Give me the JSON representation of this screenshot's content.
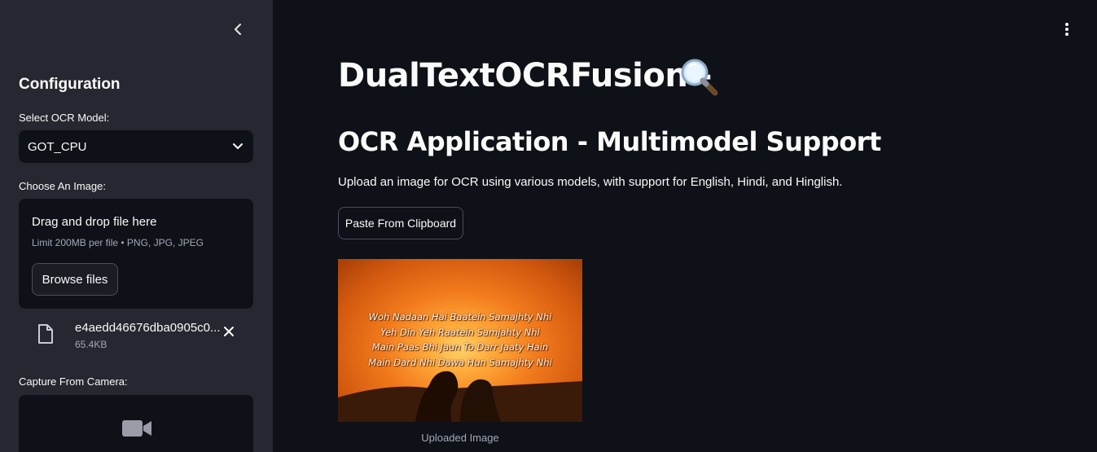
{
  "sidebar": {
    "heading": "Configuration",
    "model_label": "Select OCR Model:",
    "model_value": "GOT_CPU",
    "image_label": "Choose An Image:",
    "dropzone_title": "Drag and drop file here",
    "dropzone_limit": "Limit 200MB per file • PNG, JPG, JPEG",
    "browse_label": "Browse files",
    "file_name": "e4aedd46676dba0905c0...",
    "file_size": "65.4KB",
    "camera_label": "Capture From Camera:"
  },
  "main": {
    "title": "DualTextOCRFusion -",
    "subtitle": "OCR Application - Multimodel Support",
    "description": "Upload an image for OCR using various models, with support for English, Hindi, and Hinglish.",
    "paste_button": "Paste From Clipboard",
    "image_lines": [
      "Woh Nadaan Hai Baatein Samajhty Nhi",
      "Yeh Din Yeh Raatein Samjahty Nhi",
      "Main Paas Bhi Jaun To Darr Jaaty Hain",
      "Main Dard Nhi Dawa Hun Samajhty Nhi"
    ],
    "image_caption": "Uploaded Image"
  },
  "icons": {
    "collapse": "chevron-left-icon",
    "select": "chevron-down-icon",
    "file": "file-icon",
    "remove": "close-icon",
    "camera": "video-camera-icon",
    "menu": "more-vertical-icon",
    "title_emoji": "magnifying-glass-icon"
  },
  "colors": {
    "background": "#0e1117",
    "sidebar": "#262730",
    "text": "#fafafa",
    "muted": "#a3a8b8",
    "border": "#4a4c58"
  }
}
